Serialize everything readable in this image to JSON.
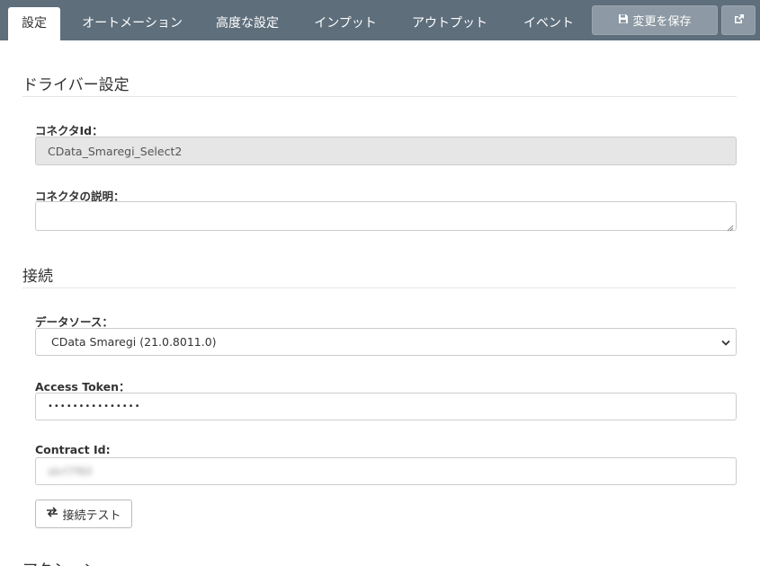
{
  "tabs": [
    {
      "label": "設定",
      "active": true
    },
    {
      "label": "オートメーション"
    },
    {
      "label": "高度な設定"
    },
    {
      "label": "インプット"
    },
    {
      "label": "アウトプット"
    },
    {
      "label": "イベント"
    }
  ],
  "toolbar": {
    "save_label": "変更を保存",
    "save_icon": "floppy-disk-icon",
    "external_icon": "external-link-icon"
  },
  "driver_section": {
    "title": "ドライバー設定",
    "connector_id_label": "コネクタId：",
    "connector_id_value": "CData_Smaregi_Select2",
    "description_label": "コネクタの説明：",
    "description_value": ""
  },
  "connection_section": {
    "title": "接続",
    "datasource_label": "データソース：",
    "datasource_value": "CData Smaregi (21.0.8011.0)",
    "access_token_label": "Access Token：",
    "access_token_value": "•••••••••••••••",
    "contract_id_label": "Contract Id:",
    "contract_id_value": "skrl7f6ll",
    "test_button_label": "接続テスト",
    "test_button_icon": "exchange-arrows-icon"
  },
  "next_section": {
    "title": "アクション"
  },
  "colors": {
    "tabbar": "#5e6e7b",
    "button": "#8d99a4",
    "readonly": "#e6e6e6"
  }
}
